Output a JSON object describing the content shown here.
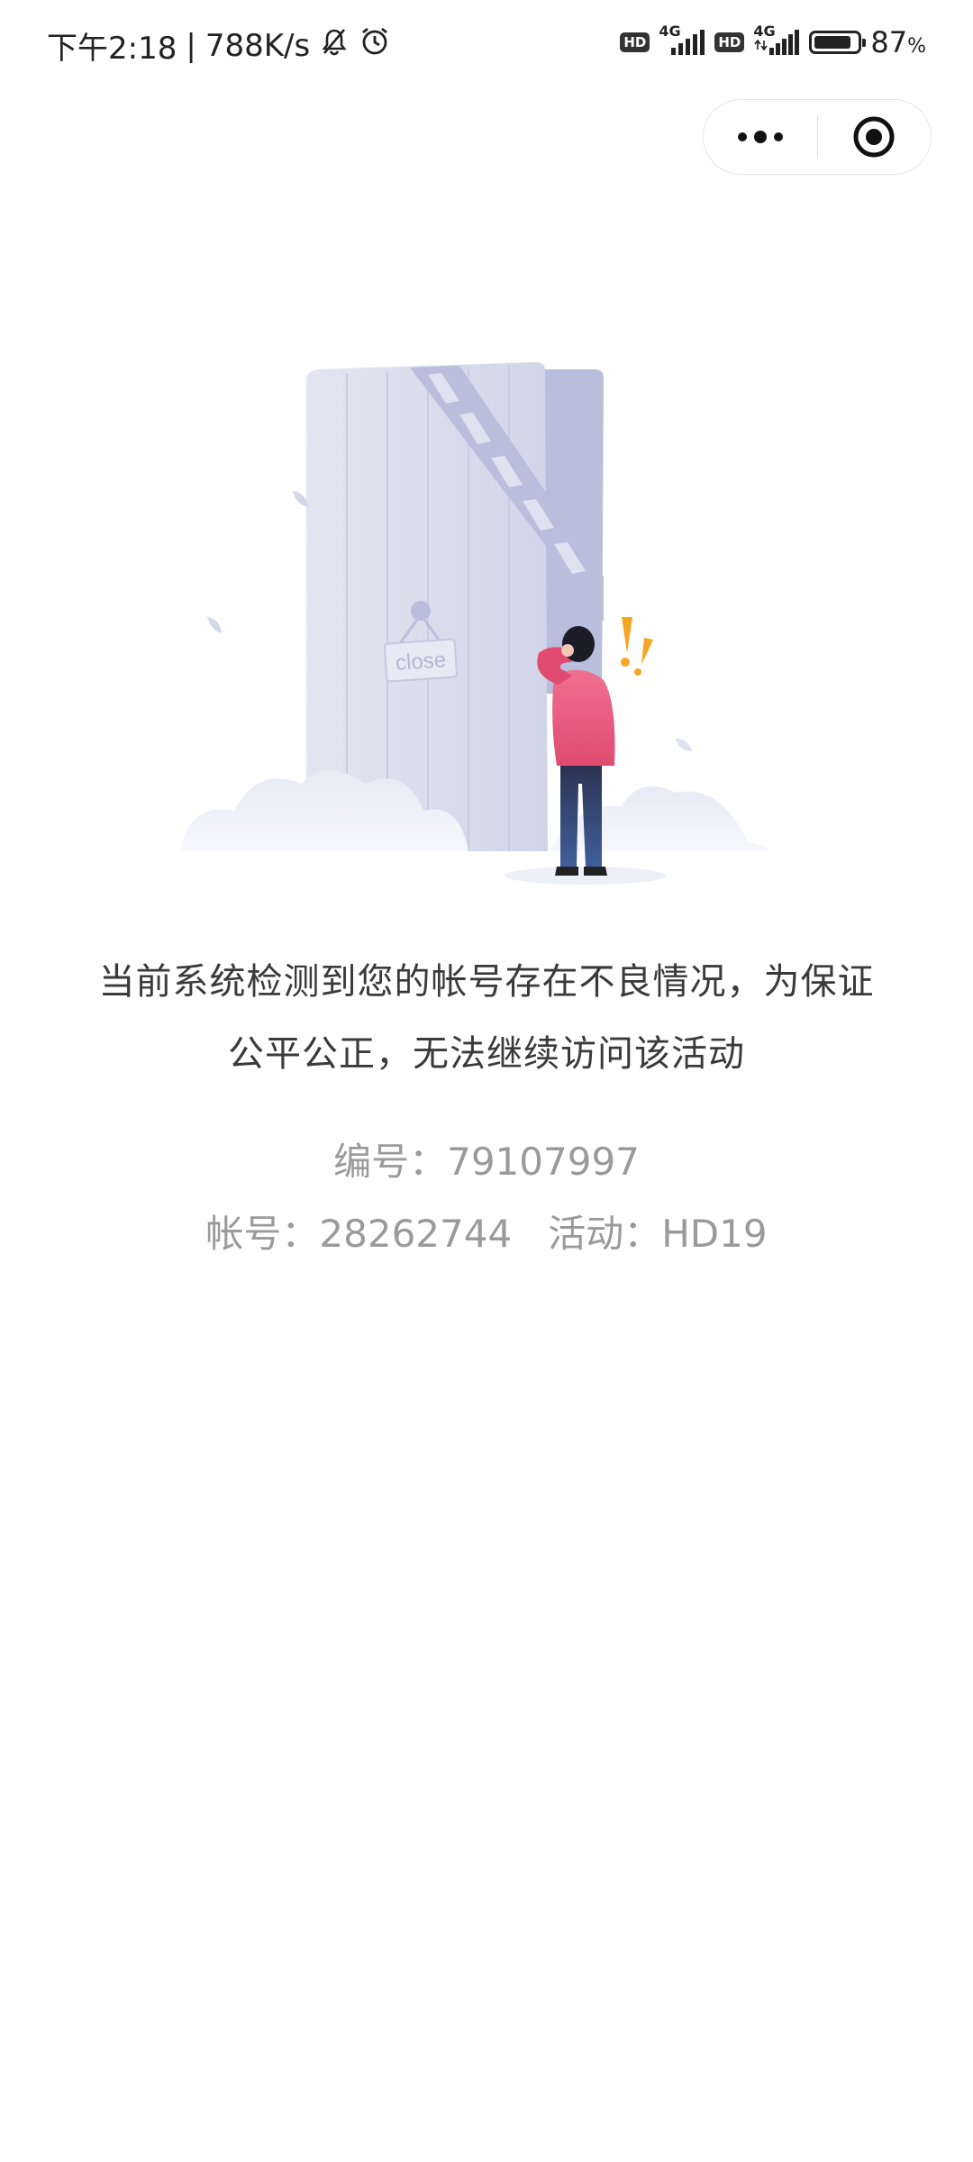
{
  "status_bar": {
    "time": "下午2:18",
    "network_speed": "788K/s",
    "hd_badge_1": "HD",
    "net_1": "4G",
    "hd_badge_2": "HD",
    "net_2": "4G",
    "battery_percent": "87",
    "battery_unit": "%",
    "battery_level": 0.87
  },
  "capsule": {
    "more_icon": "ellipsis-icon",
    "close_icon": "target-close-icon"
  },
  "illustration": {
    "door_sign": "close",
    "exclaim": "!!"
  },
  "message": {
    "line1": "当前系统检测到您的帐号存在不良情况，为保证",
    "line2": "公平公正，无法继续访问该活动"
  },
  "meta": {
    "serial_label": "编号：",
    "serial_value": "79107997",
    "account_label": "帐号：",
    "account_value": "28262744",
    "activity_label": "活动：",
    "activity_value": "HD19"
  },
  "colors": {
    "text_primary": "#3a3a3a",
    "text_secondary": "#9a9a9a",
    "door": "#d6d9ea",
    "person_shirt": "#e8557a",
    "exclaim": "#f5a623"
  }
}
